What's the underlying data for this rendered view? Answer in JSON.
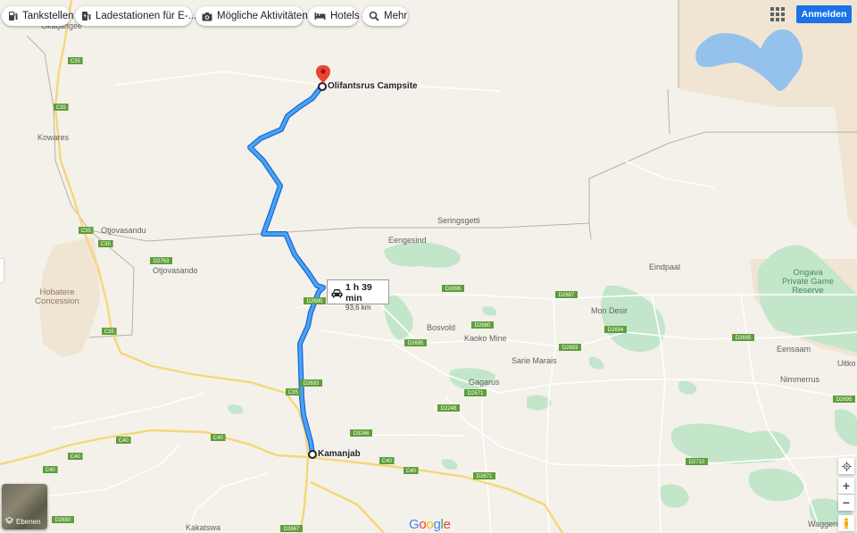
{
  "chips": [
    {
      "label": "Tankstellen",
      "icon": "gas-station-icon"
    },
    {
      "label": "Ladestationen für E-...",
      "icon": "ev-charger-icon"
    },
    {
      "label": "Mögliche Aktivitäten",
      "icon": "camera-icon"
    },
    {
      "label": "Hotels",
      "icon": "bed-icon"
    },
    {
      "label": "Mehr",
      "icon": "search-icon"
    }
  ],
  "signin_label": "Anmelden",
  "route": {
    "start": "Kamanjab",
    "end": "Olifantsrus Campsite",
    "duration": "1 h 39 min",
    "distance": "93,6 km"
  },
  "places": [
    "Okatjangee",
    "Kowares",
    "Otjovasandu",
    "Otjovasando",
    "Hobatere Concession",
    "Seringsgetti",
    "Eengesind",
    "Eindpaal",
    "Ongava Private Game Reserve",
    "Mon Desir",
    "Bosvold",
    "Kaoko Mine",
    "Sarie Marais",
    "Eensaam",
    "Uitko",
    "Nimmerrus",
    "Gagarus",
    "Kakatswa",
    "Waggenbo"
  ],
  "road_labels": [
    "C35",
    "C35",
    "C35",
    "C35",
    "C35",
    "C35",
    "D2763",
    "D2695",
    "D2696",
    "D2697",
    "D2680",
    "D2694",
    "D2695",
    "D2693",
    "D2693",
    "D2671",
    "D2248",
    "D3246",
    "D2671",
    "D2695",
    "C40",
    "C40",
    "C40",
    "C40",
    "C40",
    "C40",
    "D2710",
    "D2650",
    "D2667",
    "D2695"
  ],
  "layers_label": "Ebenen",
  "google_logo": "Google",
  "colors": {
    "land": "#f4f1ea",
    "park": "#c3e6cb",
    "reserve": "#f0e4d3",
    "water": "#94c2ec",
    "route": "#1a73e8",
    "route_outline": "#1967d2",
    "road_major": "#fbe39b",
    "road_minor": "#ffffff",
    "boundary": "#b9b0a3",
    "accent": "#1a73e8",
    "pin": "#ea4335"
  },
  "controls": {
    "locate": "my-location-icon",
    "zoom_in": "+",
    "zoom_out": "−",
    "pegman": "pegman-icon"
  }
}
